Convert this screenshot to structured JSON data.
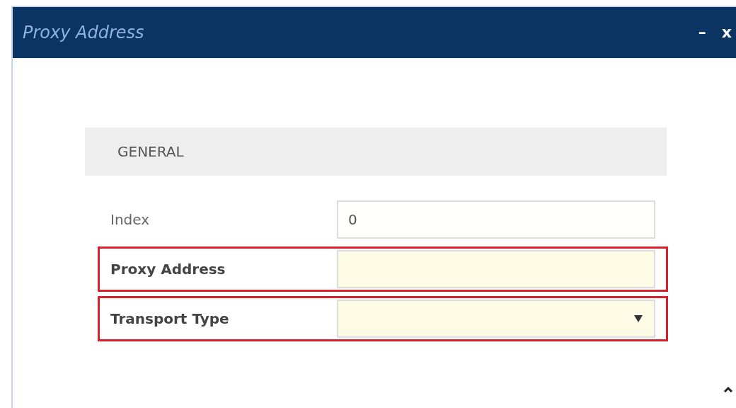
{
  "window": {
    "title": "Proxy Address",
    "controls": [
      "–",
      "x"
    ]
  },
  "section": {
    "title": "GENERAL"
  },
  "fields": [
    {
      "label": "Index",
      "kind": "text",
      "value": "0",
      "highlighted": false
    },
    {
      "label": "Proxy Address",
      "kind": "text",
      "highlighted": true
    },
    {
      "label": "Transport Type",
      "kind": "select",
      "highlighted": true
    }
  ]
}
